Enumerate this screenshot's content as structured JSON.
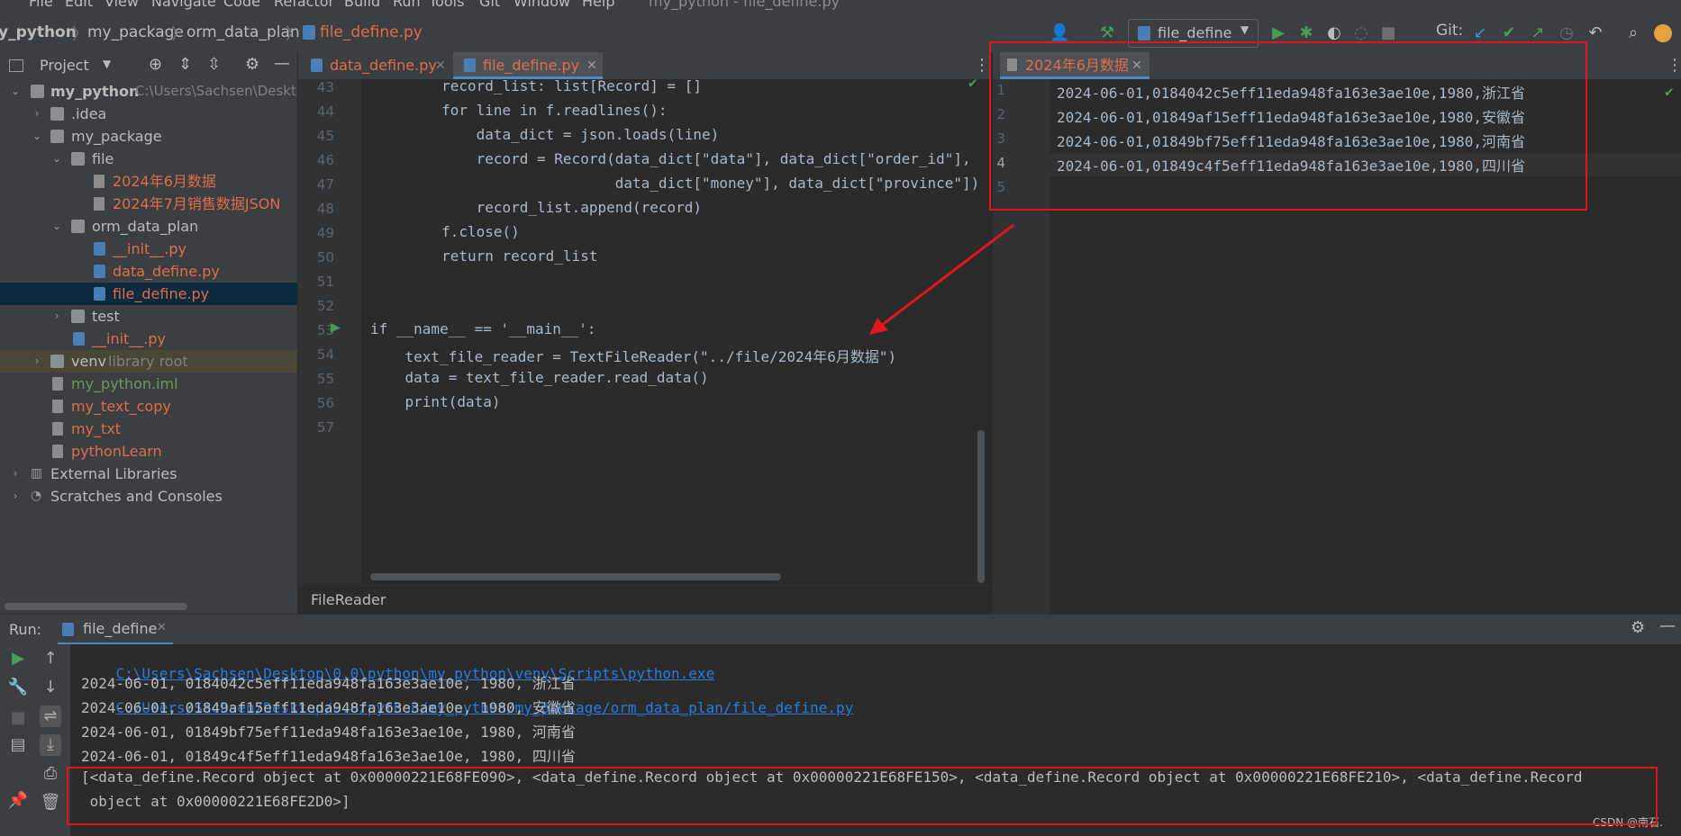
{
  "menu": [
    "File",
    "Edit",
    "View",
    "Navigate",
    "Code",
    "Refactor",
    "Build",
    "Run",
    "Tools",
    "Git",
    "Window",
    "Help"
  ],
  "window_title": "my_python - file_define.py",
  "breadcrumbs": [
    "y_python",
    "my_package",
    "orm_data_plan",
    "file_define.py"
  ],
  "run_config": "file_define",
  "git_label": "Git:",
  "project_panel": {
    "title": "Project",
    "tree": [
      {
        "label": "my_python",
        "hint": "C:\\Users\\Sachsen\\Desktop",
        "kind": "root",
        "color": "#bbbbbb"
      },
      {
        "label": ".idea",
        "kind": "folder",
        "color": "#bbbbbb"
      },
      {
        "label": "my_package",
        "kind": "folder",
        "color": "#bbbbbb"
      },
      {
        "label": "file",
        "kind": "folder",
        "color": "#bbbbbb"
      },
      {
        "label": "2024年6月数据",
        "kind": "txt",
        "color": "#e06c4a"
      },
      {
        "label": "2024年7月销售数据JSON",
        "kind": "txt",
        "color": "#e06c4a"
      },
      {
        "label": "orm_data_plan",
        "kind": "folder",
        "color": "#bbbbbb"
      },
      {
        "label": "__init__.py",
        "kind": "py",
        "color": "#e06c4a"
      },
      {
        "label": "data_define.py",
        "kind": "py",
        "color": "#e06c4a"
      },
      {
        "label": "file_define.py",
        "kind": "py",
        "color": "#e06c4a"
      },
      {
        "label": "test",
        "kind": "folder",
        "color": "#bbbbbb"
      },
      {
        "label": "__init__.py",
        "kind": "py",
        "color": "#e06c4a"
      },
      {
        "label": "venv",
        "hint": "library root",
        "kind": "folder",
        "color": "#bbbbbb"
      },
      {
        "label": "my_python.iml",
        "kind": "txt",
        "color": "#6a9955"
      },
      {
        "label": "my_text_copy",
        "kind": "txt",
        "color": "#e06c4a"
      },
      {
        "label": "my_txt",
        "kind": "txt",
        "color": "#e06c4a"
      },
      {
        "label": "pythonLearn",
        "kind": "txt",
        "color": "#e06c4a"
      },
      {
        "label": "External Libraries",
        "kind": "lib",
        "color": "#bbbbbb"
      },
      {
        "label": "Scratches and Consoles",
        "kind": "scratch",
        "color": "#bbbbbb"
      }
    ]
  },
  "editor_tabs": [
    {
      "label": "data_define.py",
      "active": false
    },
    {
      "label": "file_define.py",
      "active": true
    }
  ],
  "editor": {
    "line_numbers": [
      "43",
      "44",
      "45",
      "46",
      "47",
      "48",
      "49",
      "50",
      "51",
      "52",
      "53",
      "54",
      "55",
      "56",
      "57"
    ],
    "lines": [
      "        record_list: list[Record] = []",
      "        for line in f.readlines():",
      "            data_dict = json.loads(line)",
      "            record = Record(data_dict[\"data\"], data_dict[\"order_id\"],",
      "                            data_dict[\"money\"], data_dict[\"province\"])",
      "            record_list.append(record)",
      "        f.close()",
      "        return record_list",
      "",
      "",
      "if __name__ == '__main__':",
      "    text_file_reader = TextFileReader(\"../file/2024年6月数据\")",
      "    data = text_file_reader.read_data()",
      "    print(data)",
      ""
    ],
    "breadcrumb": "FileReader"
  },
  "right_pane": {
    "tab": "2024年6月数据",
    "line_numbers": [
      "1",
      "2",
      "3",
      "4",
      "5"
    ],
    "lines": [
      "2024-06-01,0184042c5eff11eda948fa163e3ae10e,1980,浙江省",
      "2024-06-01,01849af15eff11eda948fa163e3ae10e,1980,安徽省",
      "2024-06-01,01849bf75eff11eda948fa163e3ae10e,1980,河南省",
      "2024-06-01,01849c4f5eff11eda948fa163e3ae10e,1980,四川省",
      ""
    ]
  },
  "run_panel": {
    "label": "Run:",
    "tab": "file_define",
    "cmd_exe": "C:\\Users\\Sachsen\\Desktop\\0.0\\python\\my_python\\venv\\Scripts\\python.exe",
    "cmd_script": "C:/Users/Sachsen/Desktop/0.0/python/my_python/my_package/orm_data_plan/file_define.py",
    "output": [
      "2024-06-01, 0184042c5eff11eda948fa163e3ae10e, 1980, 浙江省",
      "2024-06-01, 01849af15eff11eda948fa163e3ae10e, 1980, 安徽省",
      "2024-06-01, 01849bf75eff11eda948fa163e3ae10e, 1980, 河南省",
      "2024-06-01, 01849c4f5eff11eda948fa163e3ae10e, 1980, 四川省"
    ],
    "result_line1": "[<data_define.Record object at 0x00000221E68FE090>, <data_define.Record object at 0x00000221E68FE150>, <data_define.Record object at 0x00000221E68FE210>, <data_define.Record",
    "result_line2": " object at 0x00000221E68FE2D0>]"
  },
  "watermark": "CSDN @南石.",
  "colors": {
    "accent_red": "#e0161c",
    "link": "#287bde",
    "modified_file": "#e06c4a"
  }
}
